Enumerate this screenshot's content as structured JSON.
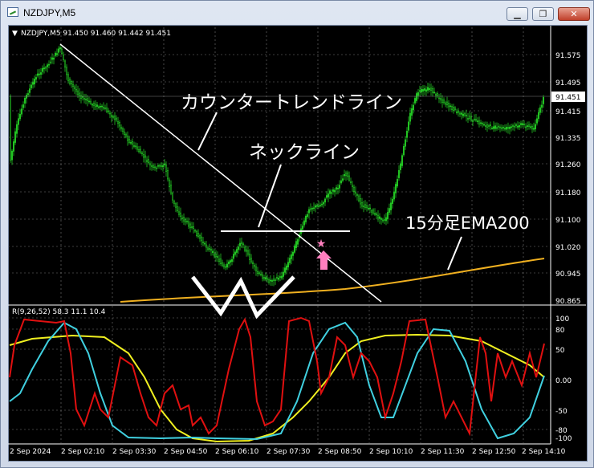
{
  "window": {
    "title": "NZDJPY,M5",
    "minimize_glyph": "▁",
    "maximize_glyph": "❐",
    "close_glyph": "✕"
  },
  "main_chart": {
    "header": "NZDJPY,M5  91.450 91.460 91.442 91.451",
    "current_price": "91.451",
    "price_labels": [
      "91.575",
      "91.495",
      "91.415",
      "91.335",
      "91.260",
      "91.180",
      "91.100",
      "91.020",
      "90.945",
      "90.865"
    ],
    "annotations": {
      "counter_trendline": "カウンタートレンドライン",
      "neckline": "ネックライン",
      "ema": "15分足EMA200"
    }
  },
  "indicator": {
    "header": "R(9,26,52) 58.3 11.1 10.4",
    "levels": [
      "100",
      "80",
      "50",
      "0.00",
      "-50",
      "-80",
      "-100"
    ]
  },
  "time_axis": [
    "2 Sep 2024",
    "2 Sep 02:10",
    "2 Sep 03:30",
    "2 Sep 04:50",
    "2 Sep 06:10",
    "2 Sep 07:30",
    "2 Sep 08:50",
    "2 Sep 10:10",
    "2 Sep 11:30",
    "2 Sep 12:50",
    "2 Sep 14:10"
  ],
  "colors": {
    "candles": "#22c322",
    "ema": "#f0b020",
    "trendline": "#ffffff",
    "arrow": "#ff7fbf",
    "rci_short": "#e01010",
    "rci_mid": "#40d0e0",
    "rci_long": "#f0f020"
  }
}
